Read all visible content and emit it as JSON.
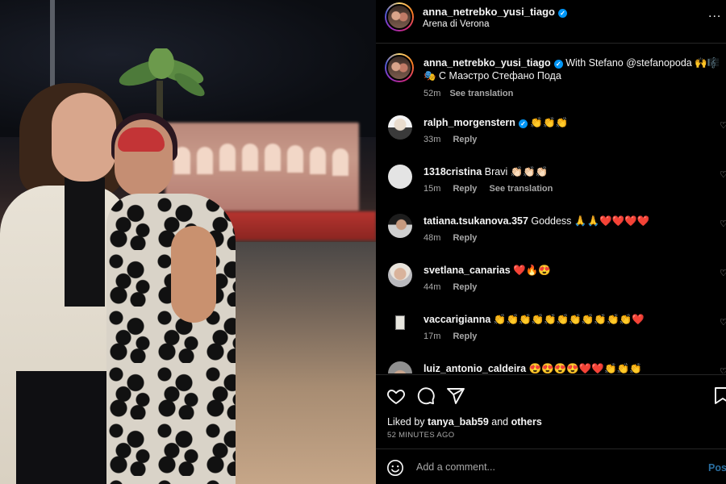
{
  "header": {
    "username": "anna_netrebko_yusi_tiago",
    "location": "Arena di Verona",
    "more_label": "..."
  },
  "caption": {
    "username": "anna_netrebko_yusi_tiago",
    "text": "With Stefano @stefanopoda 🙌🎼🎭 С Маэстро Стефано Пода",
    "time": "52m",
    "see_translation": "See translation"
  },
  "comments": [
    {
      "username": "ralph_morgenstern",
      "verified": true,
      "text": "👏👏👏",
      "time": "33m",
      "reply": "Reply",
      "see_translation": ""
    },
    {
      "username": "1318cristina",
      "verified": false,
      "text": "Bravi 👏🏻👏🏻👏🏻",
      "time": "15m",
      "reply": "Reply",
      "see_translation": "See translation"
    },
    {
      "username": "tatiana.tsukanova.357",
      "verified": false,
      "text": "Goddess 🙏🙏❤️❤️❤️❤️",
      "time": "48m",
      "reply": "Reply",
      "see_translation": ""
    },
    {
      "username": "svetlana_canarias",
      "verified": false,
      "text": "❤️🔥😍",
      "time": "44m",
      "reply": "Reply",
      "see_translation": ""
    },
    {
      "username": "vaccarigianna",
      "verified": false,
      "text": "👏👏👏👏👏👏👏👏👏👏👏❤️",
      "time": "17m",
      "reply": "Reply",
      "see_translation": ""
    },
    {
      "username": "luiz_antonio_caldeira",
      "verified": false,
      "text": "😍😍😍😍❤️❤️👏👏👏",
      "time": "",
      "reply": "",
      "see_translation": ""
    }
  ],
  "likes": {
    "prefix": "Liked by",
    "user": "tanya_bab59",
    "and": "and",
    "others": "others",
    "time_ago": "52 MINUTES AGO"
  },
  "add_comment": {
    "placeholder": "Add a comment...",
    "post_label": "Post"
  },
  "colors": {
    "background": "#000000",
    "text": "#f5f5f5",
    "muted": "#a8a8a8",
    "verified": "#0095f6",
    "post_button": "#2a6ea0"
  },
  "icons": {
    "verified": "verified-badge-icon",
    "more": "more-options-icon",
    "like": "heart-icon",
    "comment": "comment-icon",
    "share": "share-icon",
    "save": "bookmark-icon",
    "emoji": "emoji-icon"
  }
}
